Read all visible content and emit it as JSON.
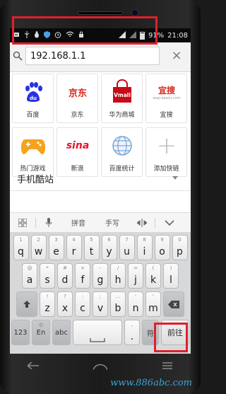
{
  "status_bar": {
    "left_icons": [
      "usb-icon",
      "usb-debug-icon",
      "shield-icon",
      "alarm-icon",
      "wifi-icon"
    ],
    "battery": "91%",
    "time": "21:08"
  },
  "address_bar": {
    "url_value": "192.168.1.1",
    "clear_symbol": "×"
  },
  "shortcuts": [
    {
      "name": "百度",
      "logo_text": "du"
    },
    {
      "name": "京东",
      "logo_text": "京东"
    },
    {
      "name": "华为商城",
      "logo_text": "Vmall"
    },
    {
      "name": "宜搜",
      "logo_text": "宜搜",
      "logo_subtext": "wap.easou.com"
    },
    {
      "name": "热门游戏",
      "logo_text": ""
    },
    {
      "name": "新浪",
      "logo_text": "sina"
    },
    {
      "name": "百度统计",
      "logo_text": ""
    },
    {
      "name": "添加快链",
      "logo_text": "+"
    }
  ],
  "mobile_sites": {
    "label": "手机酷站"
  },
  "ime_toolbar": {
    "pinyin": "拼音",
    "handwriting": "手写"
  },
  "keyboard": {
    "row1": [
      {
        "key": "q",
        "sub": "1"
      },
      {
        "key": "w",
        "sub": "2"
      },
      {
        "key": "e",
        "sub": "3"
      },
      {
        "key": "r",
        "sub": "4"
      },
      {
        "key": "t",
        "sub": "5"
      },
      {
        "key": "y",
        "sub": "6"
      },
      {
        "key": "u",
        "sub": "7"
      },
      {
        "key": "i",
        "sub": "8"
      },
      {
        "key": "o",
        "sub": "9"
      },
      {
        "key": "p",
        "sub": "0"
      }
    ],
    "row2": [
      {
        "key": "a",
        "sub": "@"
      },
      {
        "key": "s",
        "sub": "*"
      },
      {
        "key": "d",
        "sub": "#"
      },
      {
        "key": "f",
        "sub": "+"
      },
      {
        "key": "g",
        "sub": "-"
      },
      {
        "key": "h",
        "sub": "/"
      },
      {
        "key": "j",
        "sub": "="
      },
      {
        "key": "k",
        "sub": "("
      },
      {
        "key": "l",
        "sub": ")"
      }
    ],
    "row3": [
      {
        "key": "z",
        "sub": "!"
      },
      {
        "key": "x",
        "sub": "?"
      },
      {
        "key": "c",
        "sub": ":"
      },
      {
        "key": "v",
        "sub": ";"
      },
      {
        "key": "b",
        "sub": "…"
      },
      {
        "key": "n",
        "sub": "'"
      },
      {
        "key": "m",
        "sub": "'"
      }
    ],
    "num_key": "123",
    "lang_key": "En",
    "lang_key_sub": "中",
    "abc_key": "abc",
    "symbol_key": "符",
    "go_key": "前往"
  },
  "watermark": "www.886abc.com",
  "colors": {
    "highlight": "#e0202c",
    "watermark": "#3aa4d8"
  }
}
